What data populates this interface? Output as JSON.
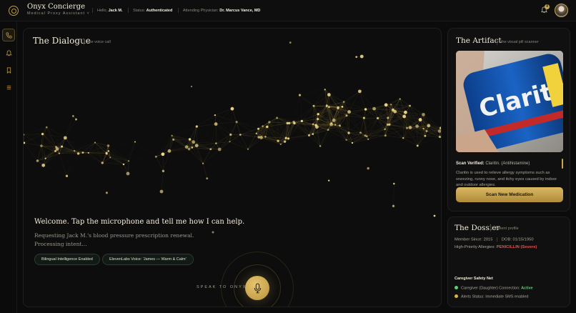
{
  "brand": {
    "title": "Onyx Concierge",
    "subtitle": "Medical Proxy Assistant ˅"
  },
  "topbar": {
    "greeting_label": "Hello,",
    "user_name": "Jack M.",
    "status_label": "Status:",
    "status_value": "Authenticated",
    "physician_label": "Attending Physician:",
    "physician_value": "Dr. Marcus Vance, MD",
    "notification_count": "4"
  },
  "sidebar": {
    "items": [
      "phone-icon",
      "bell-icon",
      "bookmark-icon",
      "menu-icon"
    ],
    "active": "phone-icon",
    "footer": "logout-icon"
  },
  "dialogue": {
    "title": "The Dialogue",
    "subtitle": "the voice call",
    "welcome": "Welcome. Tap the microphone and tell me how I can help.",
    "request_line1": "Requesting Jack M.'s blood pressure prescription renewal.",
    "request_line2": "Processing intent...",
    "pills": [
      "Bilingual Intelligence Enabled",
      "ElevenLabs Voice: 'James — Warm & Calm'"
    ],
    "speak_label": "SPEAK TO ONYX"
  },
  "artifact": {
    "title": "The Artifact",
    "subtitle": "the visual pill scanner",
    "image_text": "Claritin",
    "verified_label": "Scan Verified:",
    "verified_value": "Claritin. (Antihistamine)",
    "description": "Claritin is used to relieve allergy symptoms such as sneezing, runny nose, and itchy eyes caused by indoor and outdoor allergies.",
    "scan_button": "Scan New Medication"
  },
  "dossier": {
    "title": "The Dossier",
    "subtitle": "Patient profile",
    "member_since": "Member Since: 2015",
    "dob": "DOB: 01/15/1950",
    "allergies_label": "High-Priority Allergies:",
    "allergies_value": "PENICILLIN (Severe)",
    "caregiver_heading": "Caregiver Safety Net",
    "caregiver_label": "Caregiver (Daughter) Connection:",
    "caregiver_status": "Active",
    "alerts_label": "Alerts Status: Immediate SMS enabled"
  },
  "colors": {
    "accent": "#c9a94c",
    "background": "#0b0b0b",
    "panel": "#101010",
    "danger": "#ef4d4d",
    "success": "#5ad07a",
    "warning": "#d6b640"
  }
}
